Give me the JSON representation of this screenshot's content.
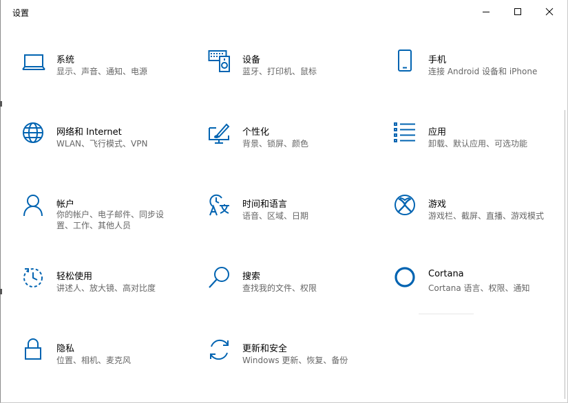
{
  "window": {
    "title": "设置",
    "controls": {
      "minimize": "minimize",
      "maximize": "maximize",
      "close": "close"
    }
  },
  "accent_color": "#0063b1",
  "tiles": [
    {
      "name": "系统",
      "desc_lines": [
        "显示、声音、通知、电源"
      ],
      "icon": "laptop-icon"
    },
    {
      "name": "设备",
      "desc_lines": [
        "蓝牙、打印机、鼠标"
      ],
      "icon": "devices-icon"
    },
    {
      "name": "手机",
      "desc_lines": [
        "连接 Android 设备和 iPhone"
      ],
      "icon": "phone-icon"
    },
    {
      "name": "网络和 Internet",
      "desc_lines": [
        "WLAN、飞行模式、VPN"
      ],
      "icon": "globe-icon"
    },
    {
      "name": "个性化",
      "desc_lines": [
        "背景、锁屏、颜色"
      ],
      "icon": "personalization-icon"
    },
    {
      "name": "应用",
      "desc_lines": [
        "卸载、默认应用、可选功能"
      ],
      "icon": "apps-list-icon"
    },
    {
      "name": "帐户",
      "desc_lines": [
        "你的帐户、电子邮件、同步设",
        "置、工作、其他人员"
      ],
      "icon": "person-icon"
    },
    {
      "name": "时间和语言",
      "desc_lines": [
        "语音、区域、日期"
      ],
      "icon": "time-language-icon"
    },
    {
      "name": "游戏",
      "desc_lines": [
        "游戏栏、截屏、直播、游戏模式"
      ],
      "icon": "xbox-icon"
    },
    {
      "name": "轻松使用",
      "desc_lines": [
        "讲述人、放大镜、高对比度"
      ],
      "icon": "ease-of-access-icon"
    },
    {
      "name": "搜索",
      "desc_lines": [
        "查找我的文件、权限"
      ],
      "icon": "search-icon"
    },
    {
      "name": "Cortana",
      "desc_lines": [
        "Cortana 语言、权限、通知"
      ],
      "icon": "cortana-icon"
    },
    {
      "name": "隐私",
      "desc_lines": [
        "位置、相机、麦克风"
      ],
      "icon": "lock-icon"
    },
    {
      "name": "更新和安全",
      "desc_lines": [
        "Windows 更新、恢复、备份"
      ],
      "icon": "update-icon"
    }
  ]
}
